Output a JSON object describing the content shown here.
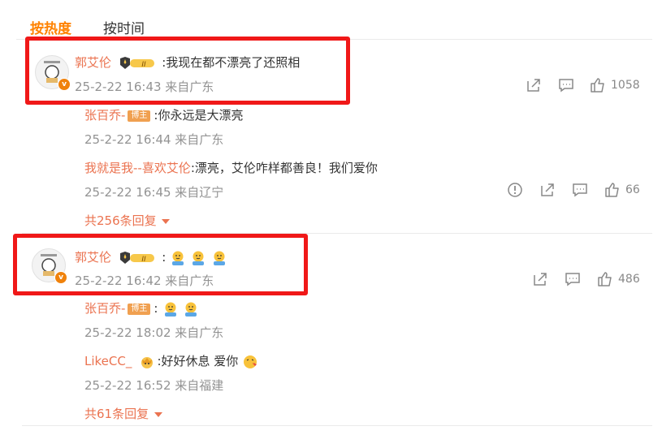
{
  "tabs": [
    {
      "label": "按热度",
      "active": true
    },
    {
      "label": "按时间",
      "active": false
    }
  ],
  "colors": {
    "accent": "#ff8200",
    "name": "#eb7350",
    "meta": "#939393",
    "highlight_box": "#f01818"
  },
  "comments": [
    {
      "user": "郭艾伦",
      "level_badge": "II",
      "text": ":我现在都不漂亮了还照相",
      "time": "25-2-22 16:43 来自广东",
      "likes": "1058",
      "replies": [
        {
          "user": "张百乔-",
          "badge": "博主",
          "text": ":你永远是大漂亮",
          "time": "25-2-22 16:44 来自广东"
        },
        {
          "user": "我就是我--喜欢艾伦",
          "text": ":漂亮，艾伦咋样都善良！我们爱你",
          "time": "25-2-22 16:45 来自辽宁",
          "likes": "66"
        }
      ],
      "more_label": "共256条回复"
    },
    {
      "user": "郭艾伦",
      "level_badge": "II",
      "text": ":",
      "emoji_count": 3,
      "time": "25-2-22 16:42 来自广东",
      "likes": "486",
      "replies": [
        {
          "user": "张百乔-",
          "badge": "博主",
          "text": ":",
          "emoji_count": 2,
          "time": "25-2-22 18:02 来自广东"
        },
        {
          "user": "LikeCC_",
          "text": ":好好休息 爱你",
          "time": "25-2-22 16:52 来自福建"
        }
      ],
      "more_label": "共61条回复"
    }
  ]
}
